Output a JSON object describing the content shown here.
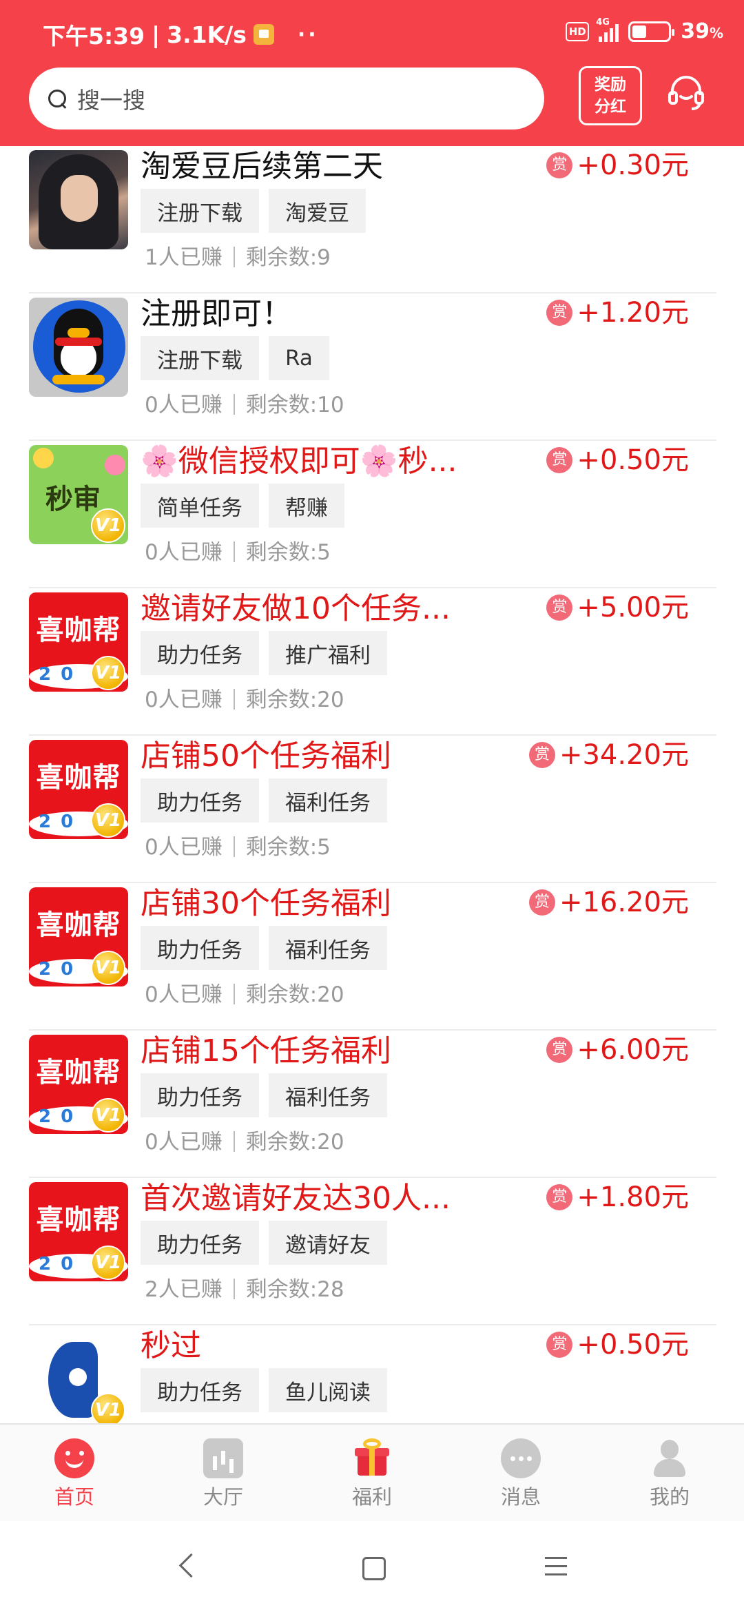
{
  "status_bar": {
    "time": "下午5:39",
    "speed": "3.1K/s",
    "more": "··",
    "hd": "HD",
    "network": "4G",
    "battery_pct": "39",
    "battery_unit": "%"
  },
  "header": {
    "search_placeholder": "搜一搜",
    "reward_line1": "奖励",
    "reward_line2": "分红"
  },
  "tasks": [
    {
      "title": "淘爱豆后续第二天",
      "title_color": "black",
      "tags": [
        "注册下载",
        "淘爱豆"
      ],
      "earned": "1人已赚",
      "remaining": "剩余数:9",
      "reward_badge": "赏",
      "reward": "+0.30元",
      "thumb": "portrait"
    },
    {
      "title": "注册即可！",
      "title_color": "black",
      "tags": [
        "注册下载",
        "Ra"
      ],
      "earned": "0人已赚",
      "remaining": "剩余数:10",
      "reward_badge": "赏",
      "reward": "+1.20元",
      "thumb": "qq-penguin"
    },
    {
      "title": "🌸微信授权即可🌸秒...",
      "title_color": "red",
      "tags": [
        "简单任务",
        "帮赚"
      ],
      "earned": "0人已赚",
      "remaining": "剩余数:5",
      "reward_badge": "赏",
      "reward": "+0.50元",
      "thumb": "miaoshen",
      "thumb_label": "秒审",
      "thumb_badge": "V1"
    },
    {
      "title": "邀请好友做10个任务...",
      "title_color": "red",
      "tags": [
        "助力任务",
        "推广福利"
      ],
      "earned": "0人已赚",
      "remaining": "剩余数:20",
      "reward_badge": "赏",
      "reward": "+5.00元",
      "thumb": "xikabang",
      "thumb_label": "喜咖帮",
      "thumb_band": "20",
      "thumb_badge": "V1"
    },
    {
      "title": "店铺50个任务福利",
      "title_color": "red",
      "tags": [
        "助力任务",
        "福利任务"
      ],
      "earned": "0人已赚",
      "remaining": "剩余数:5",
      "reward_badge": "赏",
      "reward": "+34.20元",
      "thumb": "xikabang",
      "thumb_label": "喜咖帮",
      "thumb_band": "20",
      "thumb_badge": "V1"
    },
    {
      "title": "店铺30个任务福利",
      "title_color": "red",
      "tags": [
        "助力任务",
        "福利任务"
      ],
      "earned": "0人已赚",
      "remaining": "剩余数:20",
      "reward_badge": "赏",
      "reward": "+16.20元",
      "thumb": "xikabang",
      "thumb_label": "喜咖帮",
      "thumb_band": "20",
      "thumb_badge": "V1"
    },
    {
      "title": "店铺15个任务福利",
      "title_color": "red",
      "tags": [
        "助力任务",
        "福利任务"
      ],
      "earned": "0人已赚",
      "remaining": "剩余数:20",
      "reward_badge": "赏",
      "reward": "+6.00元",
      "thumb": "xikabang",
      "thumb_label": "喜咖帮",
      "thumb_band": "20",
      "thumb_badge": "V1"
    },
    {
      "title": "首次邀请好友达30人...",
      "title_color": "red",
      "tags": [
        "助力任务",
        "邀请好友"
      ],
      "earned": "2人已赚",
      "remaining": "剩余数:28",
      "reward_badge": "赏",
      "reward": "+1.80元",
      "thumb": "xikabang",
      "thumb_label": "喜咖帮",
      "thumb_band": "20",
      "thumb_badge": "V1"
    },
    {
      "title": "秒过",
      "title_color": "red",
      "tags": [
        "助力任务",
        "鱼儿阅读"
      ],
      "earned": "",
      "remaining": "",
      "reward_badge": "赏",
      "reward": "+0.50元",
      "thumb": "fish",
      "thumb_badge": "V1"
    }
  ],
  "bottom_nav": [
    {
      "label": "首页",
      "icon": "home-smile-icon",
      "active": true
    },
    {
      "label": "大厅",
      "icon": "hall-chart-icon",
      "active": false
    },
    {
      "label": "福利",
      "icon": "gift-icon",
      "active": false
    },
    {
      "label": "消息",
      "icon": "message-icon",
      "active": false
    },
    {
      "label": "我的",
      "icon": "profile-icon",
      "active": false
    }
  ],
  "colors": {
    "brand": "#f5424a",
    "reward": "#e01818"
  }
}
